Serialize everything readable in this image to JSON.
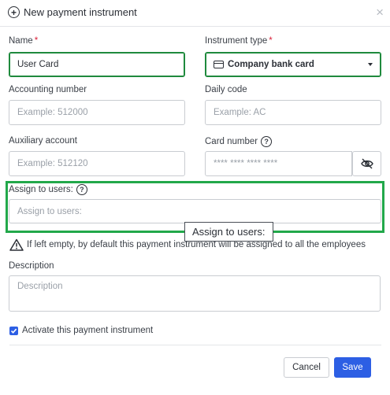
{
  "header": {
    "title": "New payment instrument",
    "close_symbol": "×"
  },
  "fields": {
    "name": {
      "label": "Name",
      "required_mark": "*",
      "value": "User Card"
    },
    "instrument_type": {
      "label": "Instrument type",
      "required_mark": "*",
      "value": "Company bank card"
    },
    "accounting_number": {
      "label": "Accounting number",
      "placeholder": "Example: 512000"
    },
    "daily_code": {
      "label": "Daily code",
      "placeholder": "Example: AC"
    },
    "auxiliary_account": {
      "label": "Auxiliary account",
      "placeholder": "Example: 512120"
    },
    "card_number": {
      "label": "Card number",
      "placeholder": "**** **** **** ****"
    },
    "assign_to_users": {
      "label": "Assign to users:",
      "placeholder": "Assign to users:"
    },
    "description": {
      "label": "Description",
      "placeholder": "Description"
    }
  },
  "help_symbol": "?",
  "tooltip": {
    "text": "Assign to users:"
  },
  "warning": {
    "text": "If left empty, by default this payment instrument will be assigned to all the employees"
  },
  "activate": {
    "label": "Activate this payment instrument",
    "checked": true
  },
  "footer": {
    "cancel_label": "Cancel",
    "save_label": "Save"
  },
  "colors": {
    "accent_green": "#1f8a3d",
    "highlight_green": "#22a84a",
    "primary_blue": "#2d5fe4",
    "required_red": "#d9223a"
  }
}
